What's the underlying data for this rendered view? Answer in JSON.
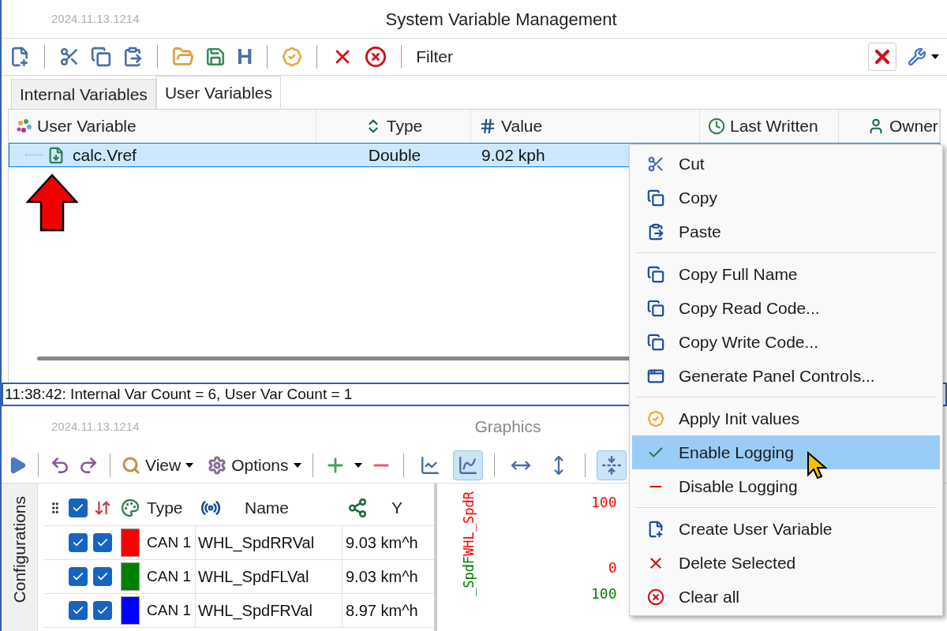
{
  "variables_window": {
    "version": "2024.11.13.1214",
    "title": "System Variable Management",
    "toolbar": {
      "h_button": "H",
      "filter_label": "Filter"
    },
    "tabs": [
      {
        "label": "Internal Variables",
        "selected": false
      },
      {
        "label": "User Variables",
        "selected": true
      }
    ],
    "table": {
      "columns": [
        "User Variable",
        "Type",
        "Value",
        "Last Written",
        "Owner"
      ],
      "rows": [
        {
          "name": "calc.Vref",
          "type": "Double",
          "value": "9.02 kph",
          "selected": true
        }
      ]
    },
    "status_bar": "11:38:42: Internal Var Count = 6, User Var Count = 1"
  },
  "graphics_window": {
    "version": "2024.11.13.1214",
    "title": "Graphics",
    "toolbar": {
      "view": "View",
      "options": "Options",
      "toggles": [
        {
          "selected": false
        },
        {
          "selected": true
        },
        {
          "selected": false
        },
        {
          "selected": false
        },
        {
          "selected": true
        }
      ]
    },
    "side_tab": "Configurations",
    "table": {
      "all_visible": true,
      "columns": [
        "Type",
        "Name",
        "Y"
      ],
      "rows": [
        {
          "visible": true,
          "logged": true,
          "color": "#ff0000",
          "type": "CAN 1",
          "name": "WHL_SpdRRVal",
          "y": "9.03 km^h"
        },
        {
          "visible": true,
          "logged": true,
          "color": "#008000",
          "type": "CAN 1",
          "name": "WHL_SpdFLVal",
          "y": "9.03 km^h"
        },
        {
          "visible": true,
          "logged": true,
          "color": "#0000ff",
          "type": "CAN 1",
          "name": "WHL_SpdFRVal",
          "y": "8.97 km^h"
        }
      ]
    },
    "axis_title": [
      {
        "text": "_SpdF",
        "color": "#008000"
      },
      {
        "text": "WHL_SpdR",
        "color": "#ff0000"
      }
    ],
    "axis_labels": [
      {
        "text": "100",
        "color": "#ff0000"
      },
      {
        "text": "0",
        "color": "#ff0000"
      },
      {
        "text": "100",
        "color": "#008000"
      }
    ]
  },
  "context_menu": {
    "groups": [
      [
        {
          "label": "Cut",
          "selected": false
        },
        {
          "label": "Copy",
          "selected": false
        },
        {
          "label": "Paste",
          "selected": false
        }
      ],
      [
        {
          "label": "Copy Full Name",
          "selected": false
        },
        {
          "label": "Copy Read Code...",
          "selected": false
        },
        {
          "label": "Copy Write Code...",
          "selected": false
        },
        {
          "label": "Generate Panel Controls...",
          "selected": false
        }
      ],
      [
        {
          "label": "Apply Init values",
          "selected": false
        },
        {
          "label": "Enable Logging",
          "selected": true
        },
        {
          "label": "Disable Logging",
          "selected": false
        }
      ],
      [
        {
          "label": "Create User Variable",
          "selected": false
        },
        {
          "label": "Delete Selected",
          "selected": false
        },
        {
          "label": "Clear all",
          "selected": false
        }
      ]
    ]
  }
}
